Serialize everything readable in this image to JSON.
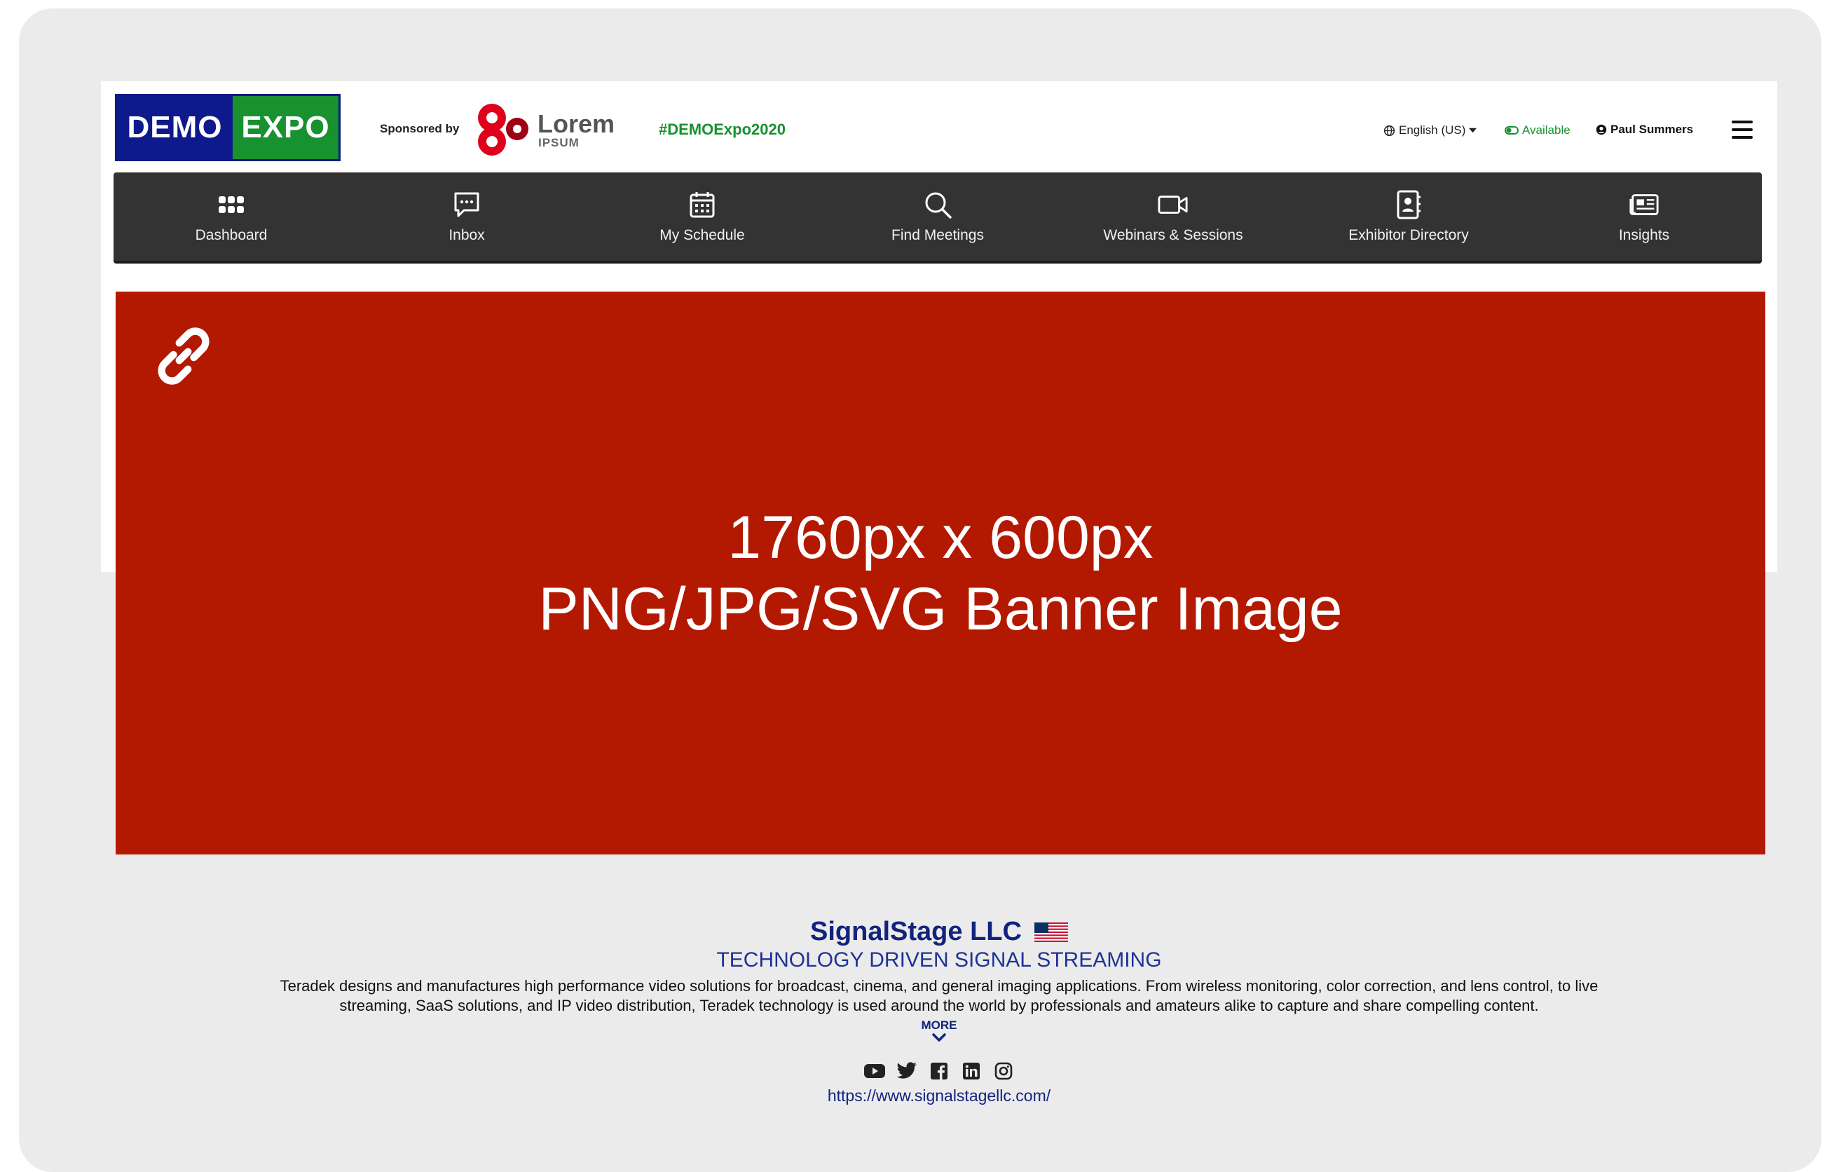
{
  "header": {
    "logo": {
      "left": "DEMO",
      "right": "EXPO"
    },
    "sponsored_label": "Sponsored by",
    "sponsor_name": "Lorem",
    "sponsor_sub": "IPSUM",
    "hashtag": "#DEMOExpo2020",
    "language": "English (US)",
    "status": "Available",
    "user_name": "Paul Summers"
  },
  "nav": {
    "items": [
      {
        "label": "Dashboard",
        "icon": "grid-icon"
      },
      {
        "label": "Inbox",
        "icon": "chat-icon"
      },
      {
        "label": "My Schedule",
        "icon": "calendar-icon"
      },
      {
        "label": "Find Meetings",
        "icon": "search-icon"
      },
      {
        "label": "Webinars & Sessions",
        "icon": "video-camera-icon"
      },
      {
        "label": "Exhibitor Directory",
        "icon": "contact-book-icon"
      },
      {
        "label": "Insights",
        "icon": "newspaper-icon"
      }
    ]
  },
  "banner": {
    "line1": "1760px x 600px",
    "line2": "PNG/JPG/SVG Banner Image",
    "color": "#b31900"
  },
  "company": {
    "name": "SignalStage LLC",
    "tagline": "TECHNOLOGY DRIVEN SIGNAL STREAMING",
    "description": "Teradek designs and manufactures high performance video solutions for broadcast, cinema, and general imaging applications. From wireless monitoring, color correction, and lens control, to live streaming, SaaS solutions, and IP video distribution, Teradek technology is used around the world by professionals and amateurs alike to capture and share compelling content.",
    "more_label": "MORE",
    "url": "https://www.signalstagellc.com/",
    "socials": [
      "youtube-icon",
      "twitter-icon",
      "facebook-icon",
      "linkedin-icon",
      "instagram-icon"
    ]
  },
  "colors": {
    "brand_blue": "#0e1a8c",
    "brand_green": "#17922f",
    "nav_bg": "#333333",
    "link_blue": "#12237d"
  }
}
